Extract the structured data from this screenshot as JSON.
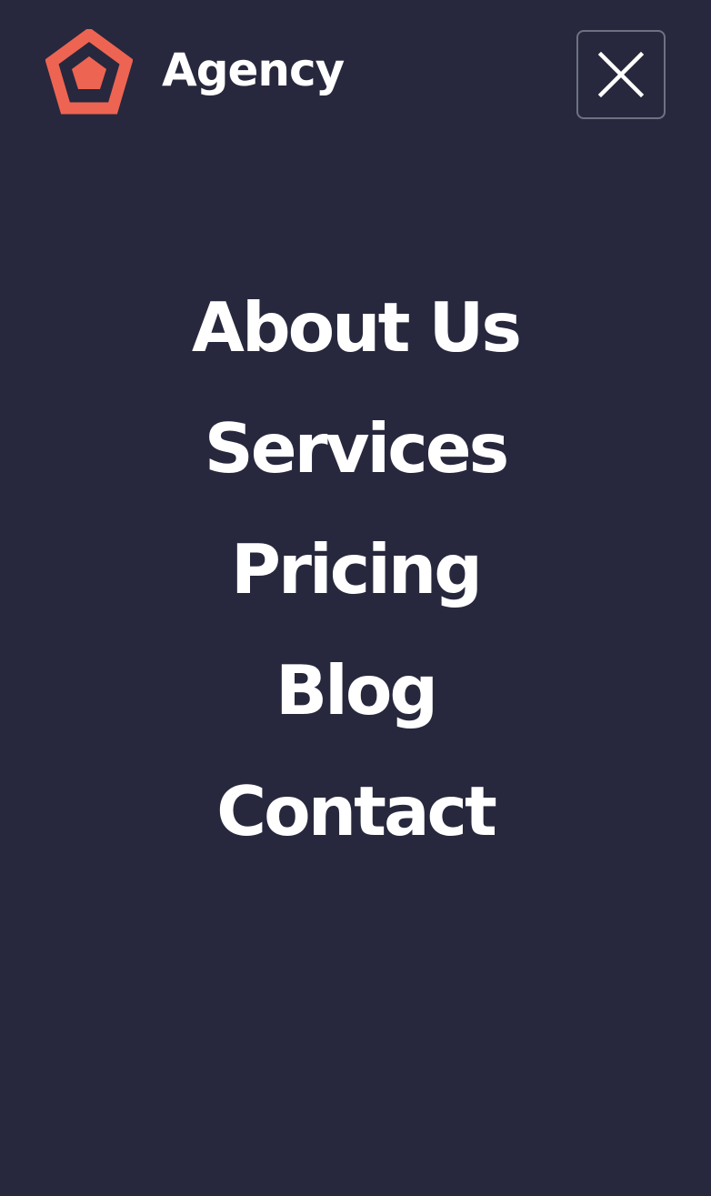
{
  "brand": {
    "name": "Agency",
    "logo_icon": "pentagon-logo-icon",
    "accent_color": "#ee6452"
  },
  "header": {
    "close_icon": "close-icon",
    "close_border_color": "#6f7182"
  },
  "colors": {
    "background": "#27283d",
    "text": "#ffffff"
  },
  "nav": {
    "items": [
      {
        "label": "About Us"
      },
      {
        "label": "Services"
      },
      {
        "label": "Pricing"
      },
      {
        "label": "Blog"
      },
      {
        "label": "Contact"
      }
    ]
  }
}
